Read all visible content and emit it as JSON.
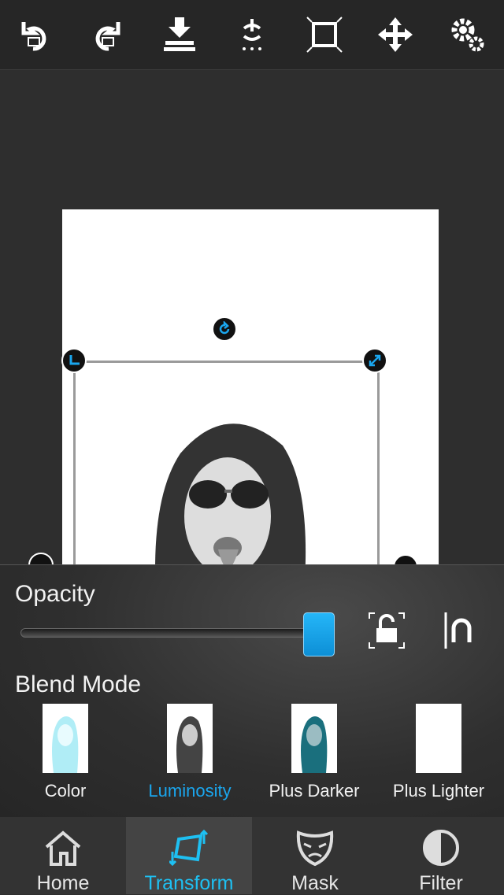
{
  "toolbar": {
    "items": [
      {
        "icon": "undo-icon"
      },
      {
        "icon": "redo-icon"
      },
      {
        "icon": "download-icon"
      },
      {
        "icon": "flip-icon"
      },
      {
        "icon": "fit-icon"
      },
      {
        "icon": "move-icon"
      },
      {
        "icon": "settings-icon"
      }
    ]
  },
  "panel": {
    "opacity_label": "Opacity",
    "opacity_value": 1.0,
    "blend_label": "Blend Mode",
    "blend_modes": [
      {
        "label": "Color",
        "active": false
      },
      {
        "label": "Luminosity",
        "active": true
      },
      {
        "label": "Plus Darker",
        "active": false
      },
      {
        "label": "Plus Lighter",
        "active": false
      }
    ]
  },
  "tabs": [
    {
      "label": "Home",
      "icon": "home-icon",
      "active": false
    },
    {
      "label": "Transform",
      "icon": "transform-icon",
      "active": true
    },
    {
      "label": "Mask",
      "icon": "mask-icon",
      "active": false
    },
    {
      "label": "Filter",
      "icon": "filter-icon",
      "active": false
    }
  ],
  "colors": {
    "accent": "#1aa6ee",
    "tab_active_text": "#1ec0f2",
    "background": "#2e2e2e"
  }
}
